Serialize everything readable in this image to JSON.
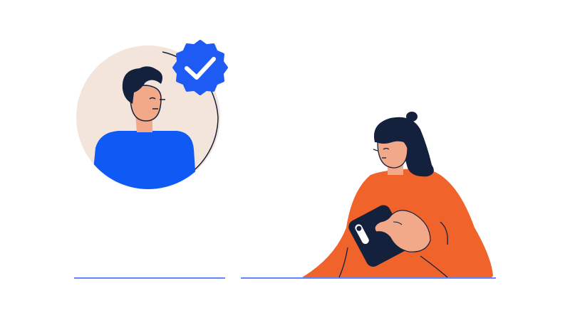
{
  "illustration": {
    "avatar_card": {
      "icon": "verified-user-avatar",
      "badge_icon": "verified-check-badge-icon",
      "colors": {
        "circle_bg": "#F3E5DB",
        "shirt": "#0F5AF5",
        "badge": "#1E5BF4",
        "skin": "#F2A98A",
        "hair": "#14213D"
      }
    },
    "person_with_phone": {
      "icon": "woman-holding-phone",
      "colors": {
        "body": "#F0632A",
        "skin": "#F2A98A",
        "hair": "#14213D",
        "phone": "#14213D"
      }
    },
    "ground_line_color": "#2F5BFF"
  }
}
